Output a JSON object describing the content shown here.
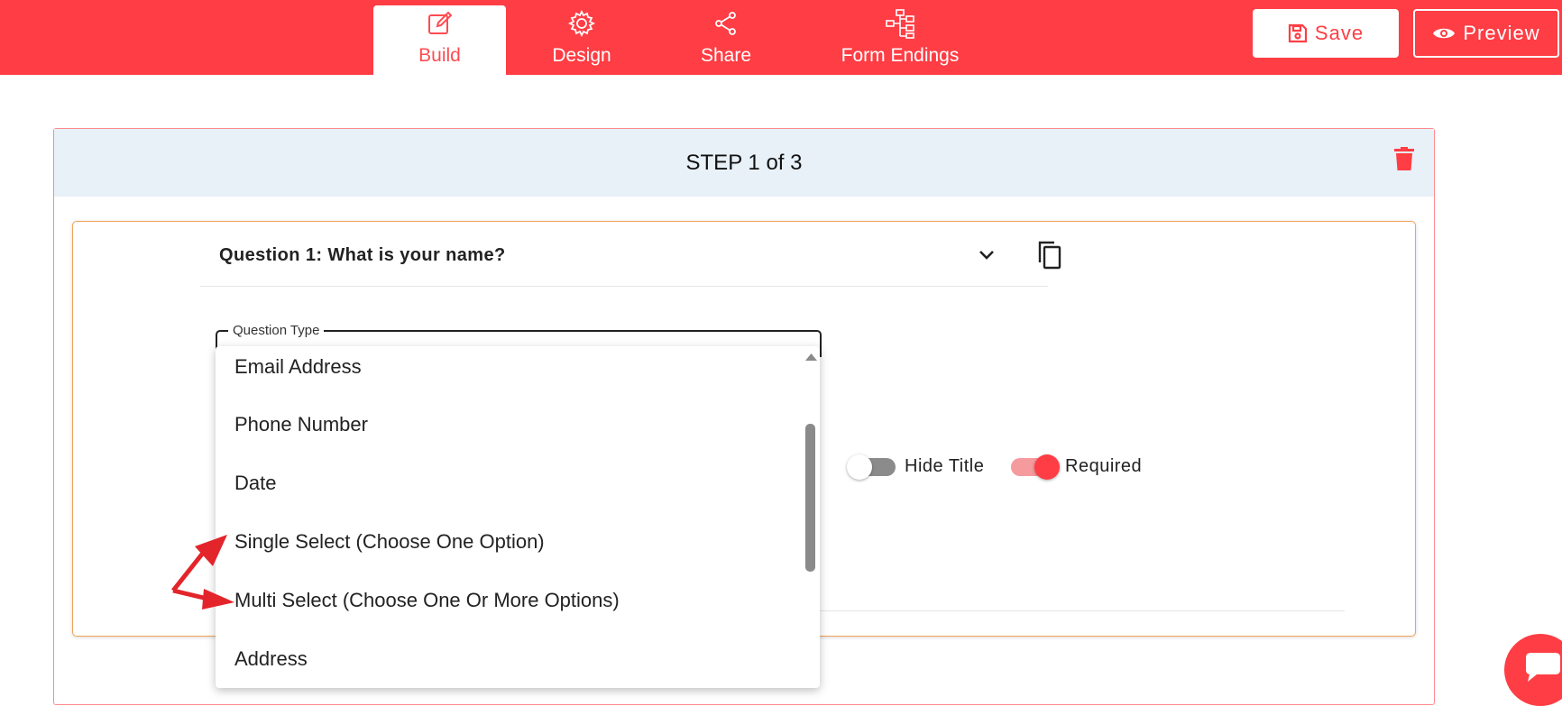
{
  "nav": {
    "tabs": [
      {
        "label": "Build",
        "icon": "edit-icon",
        "active": true
      },
      {
        "label": "Design",
        "icon": "gear-icon",
        "active": false
      },
      {
        "label": "Share",
        "icon": "share-icon",
        "active": false
      },
      {
        "label": "Form Endings",
        "icon": "flow-icon",
        "active": false
      }
    ],
    "save_label": "Save",
    "preview_label": "Preview"
  },
  "step": {
    "title": "STEP 1 of 3"
  },
  "question": {
    "title": "Question 1: What is your name?",
    "type_label": "Question Type",
    "hide_title_label": "Hide Title",
    "hide_title_on": false,
    "required_label": "Required",
    "required_on": true
  },
  "dropdown": {
    "options": [
      "Email Address",
      "Phone Number",
      "Date",
      "Single Select (Choose One Option)",
      "Multi Select (Choose One Or More Options)",
      "Address"
    ]
  },
  "colors": {
    "brand": "#ff3d44",
    "step_header_bg": "#e8f0f8",
    "question_border": "#f0a35a",
    "annotation_arrow": "#e3242b"
  }
}
